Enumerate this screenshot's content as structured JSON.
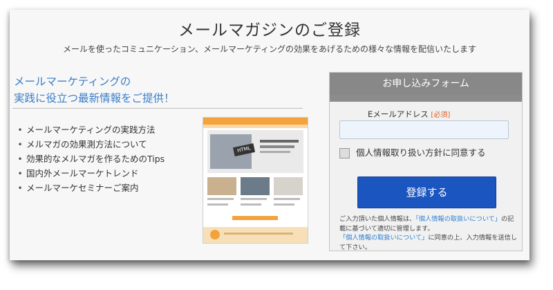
{
  "page": {
    "title": "メールマガジンのご登録",
    "subtitle": "メールを使ったコミュニケーション、メールマーケティングの効果をあげるための様々な情報を配信いたします"
  },
  "promo": {
    "headline_line1": "メールマーケティングの",
    "headline_line2": "実践に役立つ最新情報をご提供！",
    "bullet_mark": "•",
    "bullets": [
      "メールマーケティングの実践方法",
      "メルマガの効果測方法について",
      "効果的なメルマガを作るためのTips",
      "国内外メールマーケトレンド",
      "メールマーケセミナーご案内"
    ],
    "thumbnail_badge": "HTML"
  },
  "form": {
    "header": "お申し込みフォーム",
    "email_label": "Eメールアドレス",
    "required_tag": "[必須]",
    "email_value": "",
    "email_placeholder": "",
    "consent_label": "個人情報取り扱い方針に同意する",
    "consent_checked": false,
    "submit_label": "登録する",
    "note_prefix": "ご入力頂いた個人情報は、",
    "note_link1": "「個人情報の取扱いについて」",
    "note_middle": "の記載に基づいて適切に管理します。",
    "note_link2": "「個人情報の取扱いについて」",
    "note_suffix": "に同意の上、入力情報を送信して下さい。"
  },
  "colors": {
    "accent_blue": "#3a7ec6",
    "button_blue": "#1b55c0",
    "form_header_gray": "#888888",
    "required_orange": "#e06020",
    "link_blue": "#2c7fd1"
  }
}
